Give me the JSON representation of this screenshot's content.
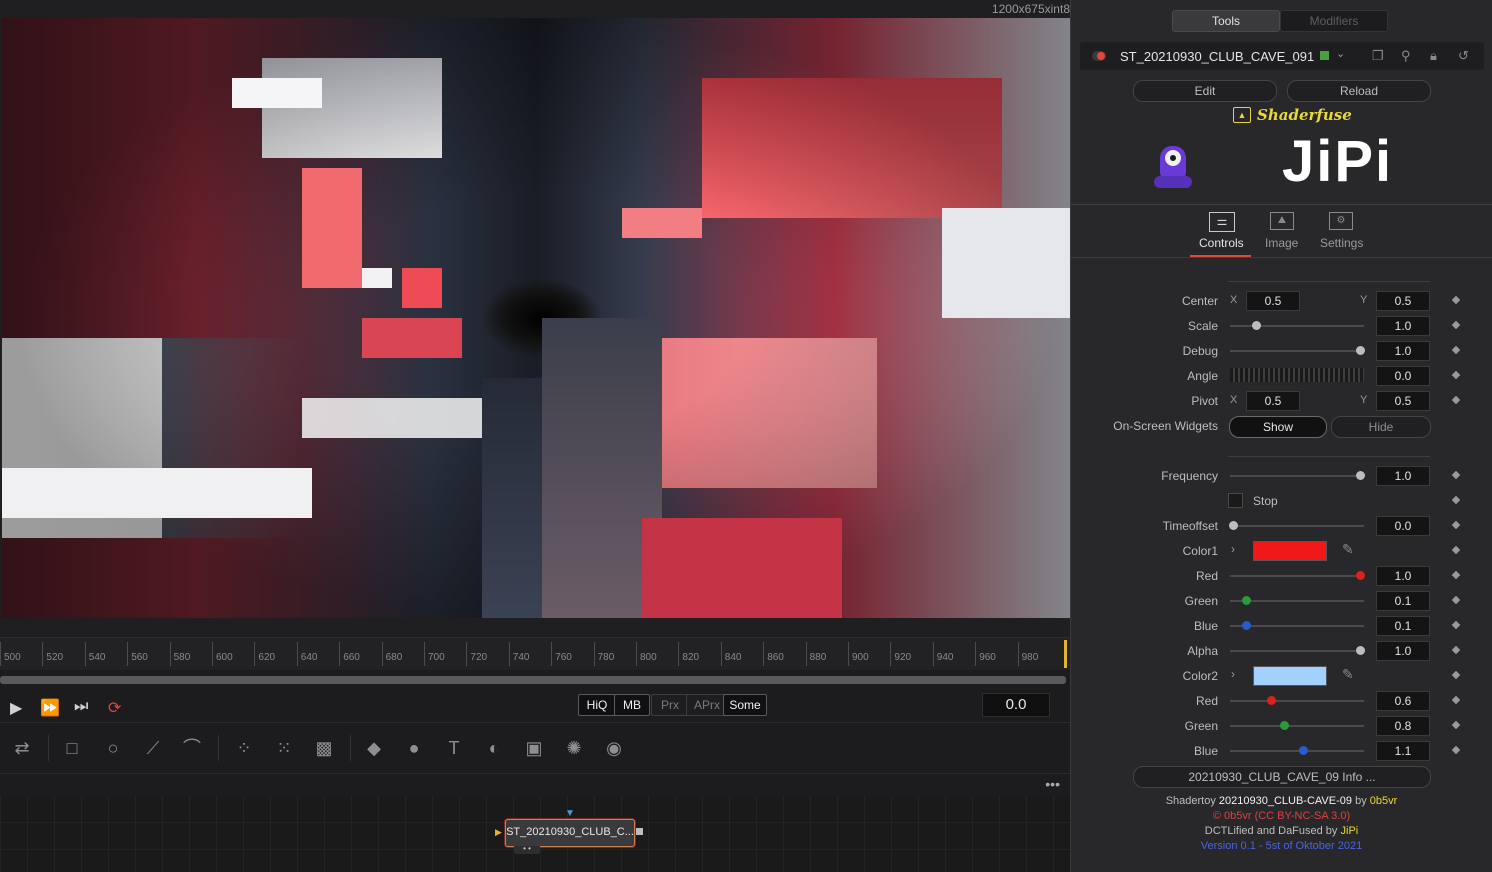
{
  "viewer": {
    "resolution": "1200x675xint8"
  },
  "timeline": {
    "ticks": [
      "500",
      "520",
      "540",
      "560",
      "580",
      "600",
      "620",
      "640",
      "660",
      "680",
      "700",
      "720",
      "740",
      "760",
      "780",
      "800",
      "820",
      "840",
      "860",
      "880",
      "900",
      "920",
      "940",
      "960",
      "980"
    ],
    "current_time": "0.0"
  },
  "transport": {
    "quality_buttons": [
      "HiQ",
      "MB",
      "Prx",
      "APrx",
      "Some"
    ]
  },
  "node": {
    "label": "ST_20210930_CLUB_C..."
  },
  "inspector": {
    "tabs": {
      "tools": "Tools",
      "modifiers": "Modifiers"
    },
    "tool_name": "ST_20210930_CLUB_CAVE_091",
    "edit_label": "Edit",
    "reload_label": "Reload",
    "brand": "Shaderfuse",
    "author_logo": "JiPi",
    "subtabs": {
      "controls": "Controls",
      "image": "Image",
      "settings": "Settings"
    },
    "controls": {
      "center_label": "Center",
      "center_x": "0.5",
      "center_y": "0.5",
      "scale_label": "Scale",
      "scale": "1.0",
      "debug_label": "Debug",
      "debug": "1.0",
      "angle_label": "Angle",
      "angle": "0.0",
      "pivot_label": "Pivot",
      "pivot_x": "0.5",
      "pivot_y": "0.5",
      "widgets_label": "On-Screen Widgets",
      "show": "Show",
      "hide": "Hide",
      "frequency_label": "Frequency",
      "frequency": "1.0",
      "stop_label": "Stop",
      "timeoffset_label": "Timeoffset",
      "timeoffset": "0.0",
      "color1_label": "Color1",
      "color1_swatch": "#f01818",
      "red1_label": "Red",
      "red1": "1.0",
      "green1_label": "Green",
      "green1": "0.1",
      "blue1_label": "Blue",
      "blue1": "0.1",
      "alpha_label": "Alpha",
      "alpha": "1.0",
      "color2_label": "Color2",
      "color2_swatch": "#a3d1ff",
      "red2_label": "Red",
      "red2": "0.6",
      "green2_label": "Green",
      "green2": "0.8",
      "blue2_label": "Blue",
      "blue2": "1.1",
      "x_label": "X",
      "y_label": "Y"
    },
    "info_button": "20210930_CLUB_CAVE_09 Info ...",
    "credits": {
      "line1_prefix": "Shadertoy",
      "line1_title": "20210930_CLUB-CAVE-09",
      "line1_by": "by",
      "line1_author": "0b5vr",
      "line2": "© 0b5vr (CC BY-NC-SA 3.0)",
      "line3_prefix": "DCTLified and DaFused by",
      "line3_author": "JiPi",
      "line4": "Version 0.1 - 5st of Oktober 2021"
    }
  }
}
